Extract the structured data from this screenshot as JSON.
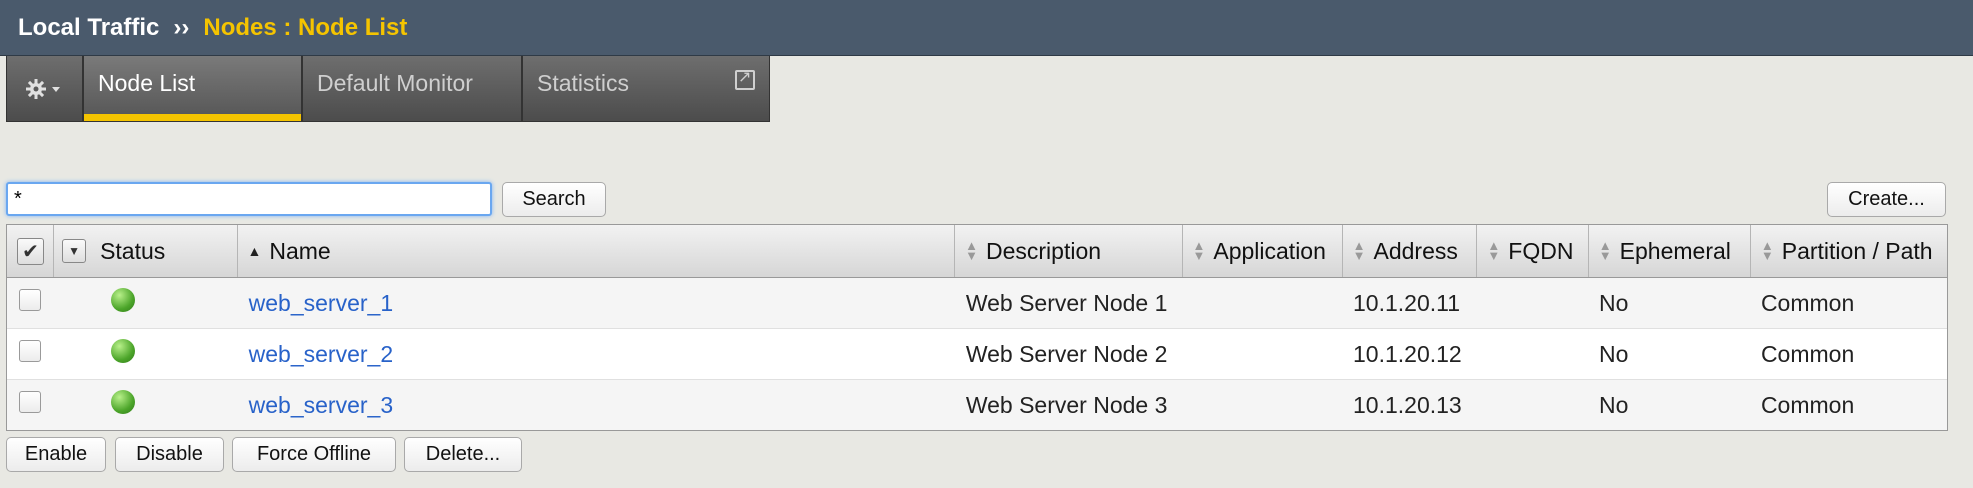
{
  "breadcrumb": {
    "section": "Local Traffic",
    "separator": "››",
    "current": "Nodes : Node List"
  },
  "tabs": [
    {
      "label": "Node List",
      "active": true
    },
    {
      "label": "Default Monitor",
      "active": false
    },
    {
      "label": "Statistics",
      "active": false
    }
  ],
  "search": {
    "value": "*",
    "button_label": "Search"
  },
  "create_label": "Create...",
  "table": {
    "columns": [
      "Status",
      "Name",
      "Description",
      "Application",
      "Address",
      "FQDN",
      "Ephemeral",
      "Partition / Path"
    ],
    "rows": [
      {
        "name": "web_server_1",
        "description": "Web Server Node 1",
        "application": "",
        "address": "10.1.20.11",
        "fqdn": "",
        "ephemeral": "No",
        "partition": "Common",
        "status": "available"
      },
      {
        "name": "web_server_2",
        "description": "Web Server Node 2",
        "application": "",
        "address": "10.1.20.12",
        "fqdn": "",
        "ephemeral": "No",
        "partition": "Common",
        "status": "available"
      },
      {
        "name": "web_server_3",
        "description": "Web Server Node 3",
        "application": "",
        "address": "10.1.20.13",
        "fqdn": "",
        "ephemeral": "No",
        "partition": "Common",
        "status": "available"
      }
    ]
  },
  "actions": {
    "enable": "Enable",
    "disable": "Disable",
    "force_offline": "Force Offline",
    "delete": "Delete..."
  },
  "colors": {
    "header_bg": "#4a5a6c",
    "accent_yellow": "#f5c400",
    "link_blue": "#2862c9",
    "status_green": "#4ca52a"
  }
}
